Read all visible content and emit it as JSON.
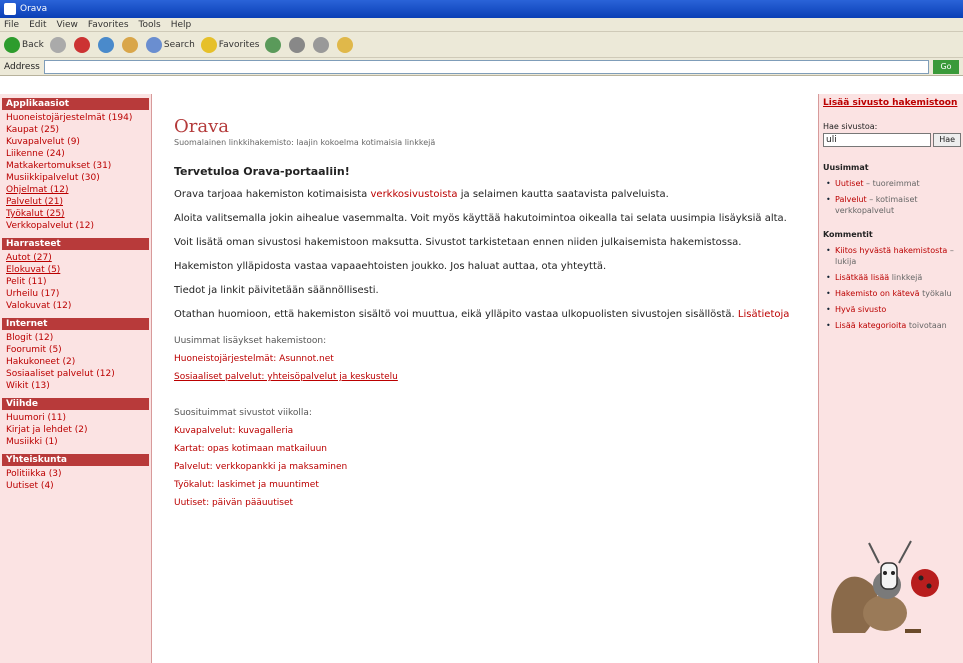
{
  "browser": {
    "title": "Orava",
    "menu": [
      "File",
      "Edit",
      "View",
      "Favorites",
      "Tools",
      "Help"
    ],
    "toolbar": {
      "back": "Back",
      "search": "Search",
      "favorites": "Favorites"
    },
    "address_label": "Address",
    "go_label": "Go"
  },
  "left": {
    "sections": [
      {
        "title": "Applikaasiot",
        "links": [
          "Huoneistojärjestelmät (194)",
          "Kaupat (25)",
          "Kuvapalvelut (9)",
          "Liikenne (24)",
          "Matkakertomukset (31)",
          "Musiikkipalvelut (30)",
          "Ohjelmat (12)",
          "Palvelut (21)",
          "Työkalut (25)",
          "Verkkopalvelut (12)"
        ]
      },
      {
        "title": "Harrasteet",
        "links": [
          "Autot (27)",
          "Elokuvat (5)",
          "Pelit (11)",
          "Urheilu (17)",
          "Valokuvat (12)"
        ]
      },
      {
        "title": "Internet",
        "links": [
          "Blogit (12)",
          "Foorumit (5)",
          "Hakukoneet (2)",
          "Sosiaaliset palvelut (12)",
          "Wikit (13)"
        ]
      },
      {
        "title": "Viihde",
        "links": [
          "Huumori (11)",
          "Kirjat ja lehdet (2)",
          "Musiikki (1)"
        ]
      },
      {
        "title": "Yhteiskunta",
        "links": [
          "Politiikka (3)",
          "Uutiset (4)"
        ]
      }
    ]
  },
  "main": {
    "site_title": "Orava",
    "site_subtitle": "Suomalainen linkkihakemisto: laajin kokoelma kotimaisia linkkejä",
    "heading": "Tervetuloa Orava-portaaliin!",
    "para1_pre": "Orava tarjoaa hakemiston kotimaisista ",
    "para1_link": "verkkosivustoista",
    "para1_post": " ja selaimen kautta saatavista palveluista.",
    "para2": "Aloita valitsemalla jokin aihealue vasemmalta. Voit myös käyttää hakutoimintoa oikealla tai selata uusimpia lisäyksiä alta.",
    "para3": "Voit lisätä oman sivustosi hakemistoon maksutta. Sivustot tarkistetaan ennen niiden julkaisemista hakemistossa.",
    "para4": "Hakemiston ylläpidosta vastaa vapaaehtoisten joukko. Jos haluat auttaa, ota yhteyttä.",
    "para5": "Tiedot ja linkit päivitetään säännöllisesti.",
    "para6_pre": "Otathan huomioon, että hakemiston sisältö voi muuttua, eikä ylläpito vastaa ulkopuolisten sivustojen sisällöstä. ",
    "para6_link": "Lisätietoja",
    "group1": {
      "label": "Uusimmat lisäykset hakemistoon:",
      "links": [
        "Huoneistojärjestelmät: Asunnot.net",
        "Sosiaaliset palvelut: yhteisöpalvelut ja keskustelu"
      ]
    },
    "group2": {
      "label": "Suosituimmat sivustot viikolla:",
      "links": [
        "Kuvapalvelut: kuvagalleria",
        "Kartat: opas kotimaan matkailuun",
        "Palvelut: verkkopankki ja maksaminen",
        "Työkalut: laskimet ja muuntimet",
        "Uutiset: päivän pääuutiset"
      ]
    }
  },
  "right": {
    "banner": "Lisää sivusto hakemistoon",
    "search_label": "Hae sivustoa:",
    "search_value": "uli",
    "search_button": "Hae",
    "section1": {
      "title": "Uusimmat",
      "items": [
        [
          "Uutiset",
          " – tuoreimmat"
        ],
        [
          "Palvelut",
          " – kotimaiset verkkopalvelut"
        ]
      ]
    },
    "section2": {
      "title": "Kommentit",
      "items": [
        [
          "Kiitos hyvästä hakemistosta",
          " – lukija"
        ],
        [
          "Lisätkää lisää",
          " linkkejä"
        ],
        [
          "Hakemisto on kätevä",
          " työkalu"
        ],
        [
          "Hyvä sivusto",
          ""
        ],
        [
          "Lisää kategorioita",
          " toivotaan"
        ]
      ]
    }
  },
  "colors": {
    "accent": "#b43a3a",
    "sidebar_bg": "#fbe3e3",
    "link": "#bb0000"
  }
}
